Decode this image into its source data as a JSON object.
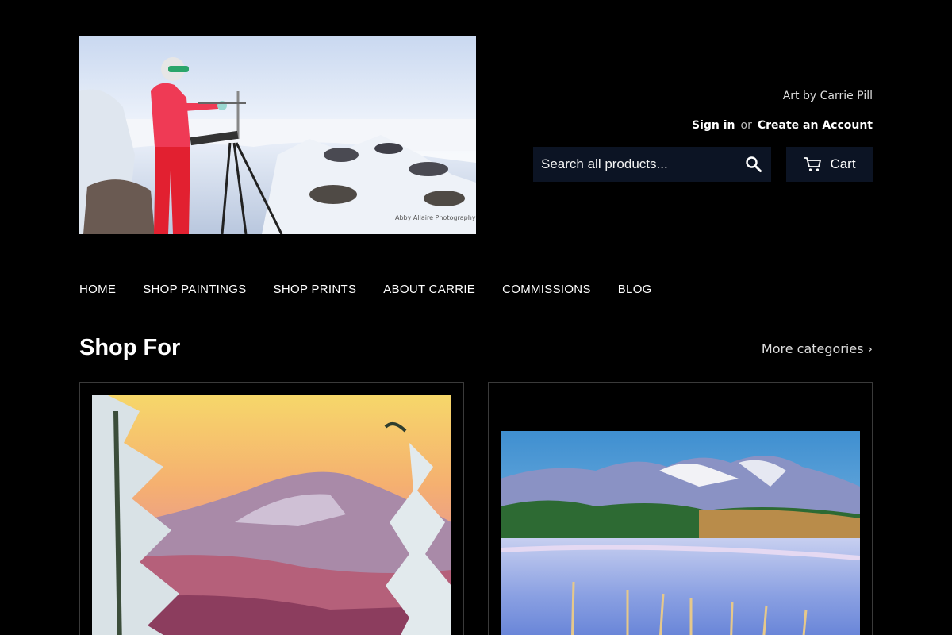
{
  "header": {
    "logo_alt": "Artist painting on a snowy mountain summit",
    "logo_credit": "Abby Allaire Photography",
    "tagline": "Art by Carrie Pill",
    "sign_in": "Sign in",
    "or": "or",
    "create_account": "Create an Account",
    "search_placeholder": "Search all products...",
    "cart_label": "Cart"
  },
  "nav": {
    "items": [
      "HOME",
      "SHOP PAINTINGS",
      "SHOP PRINTS",
      "ABOUT CARRIE",
      "COMMISSIONS",
      "BLOG"
    ]
  },
  "section": {
    "title": "Shop For",
    "more_link": "More categories ›"
  },
  "colors": {
    "background": "#000000",
    "button_bg": "#0c1424"
  },
  "icons": [
    "search-icon",
    "cart-icon"
  ]
}
